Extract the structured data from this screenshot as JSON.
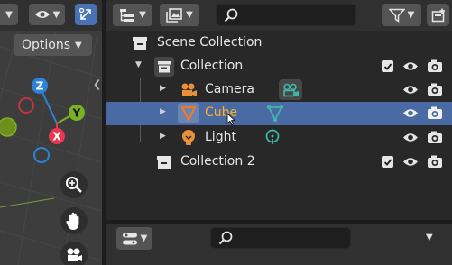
{
  "viewport": {
    "options_label": "Options",
    "gizmo": {
      "z_label": "Z",
      "y_label": "Y",
      "x_label": "X"
    },
    "colors": {
      "x": "#e8384f",
      "y": "#7ab223",
      "z": "#2b83d8",
      "background": "#3d3d3d"
    }
  },
  "outliner": {
    "search": {
      "placeholder": ""
    },
    "rows": [
      {
        "label": "Scene Collection",
        "icon": "scene-collection-icon"
      },
      {
        "label": "Collection",
        "icon": "collection-icon",
        "checked": true
      },
      {
        "label": "Camera",
        "icon": "camera-icon",
        "data_icon": "camera-data-icon"
      },
      {
        "label": "Cube",
        "icon": "mesh-cube-icon",
        "data_icon": "mesh-data-icon",
        "selected": true
      },
      {
        "label": "Light",
        "icon": "light-icon",
        "data_icon": "light-data-icon"
      },
      {
        "label": "Collection 2",
        "icon": "collection-icon",
        "checked": true
      }
    ],
    "colors": {
      "selected_row": "#4a6aa3",
      "selected_text": "#ffaf29",
      "object_orange": "#e8903a",
      "data_teal": "#3fb8a8"
    }
  },
  "bottom_editor": {
    "search": {
      "placeholder": ""
    }
  }
}
